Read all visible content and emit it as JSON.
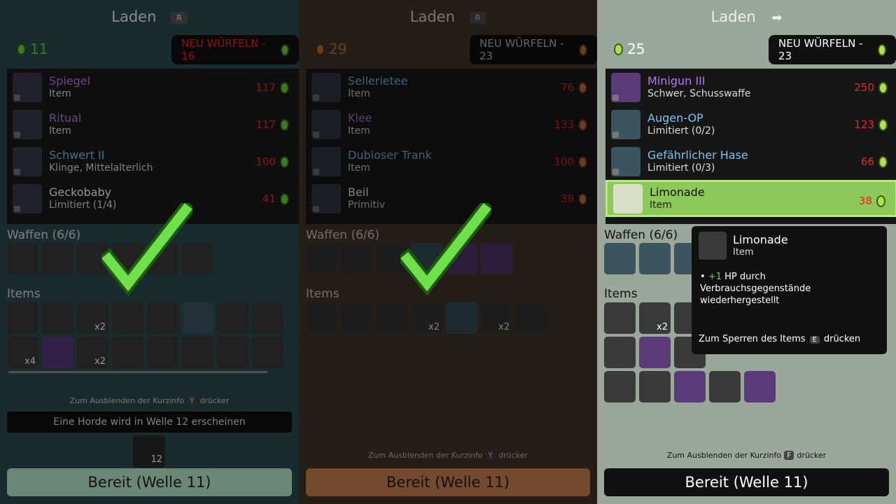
{
  "panels": [
    {
      "title": "Laden",
      "key_hint": "R",
      "coins": "11",
      "reroll_label": "NEU WÜRFELN - 16",
      "shop": [
        {
          "name": "Spiegel",
          "sub": "Item",
          "price": "117",
          "color": "purple"
        },
        {
          "name": "Ritual",
          "sub": "Item",
          "price": "117",
          "color": "purple"
        },
        {
          "name": "Schwert II",
          "sub": "Klinge, Mittelalterlich",
          "price": "100",
          "color": "blue"
        },
        {
          "name": "Geckobaby",
          "sub": "Limitiert (1/4)",
          "price": "41",
          "color": "white"
        }
      ],
      "weapons_label": "Waffen (6/6)",
      "items_label": "Items",
      "item_counts": [
        "x2",
        "x4",
        "x2"
      ],
      "hint": "Zum Ausblenden der Kurzinfo",
      "hint_key": "Y",
      "hint_end": "drücker",
      "horde": "Eine Horde wird in Welle 12 erscheinen",
      "horde_count": "12",
      "ready": "Bereit (Welle 11)"
    },
    {
      "title": "Laden",
      "key_hint": "R",
      "coins": "29",
      "reroll_label": "NEU WÜRFELN - 23",
      "shop": [
        {
          "name": "Sellerietee",
          "sub": "Item",
          "price": "76",
          "color": "blue"
        },
        {
          "name": "Klee",
          "sub": "Item",
          "price": "133",
          "color": "purple"
        },
        {
          "name": "Dubioser Trank",
          "sub": "Item",
          "price": "100",
          "color": "blue"
        },
        {
          "name": "Beil",
          "sub": "Primitiv",
          "price": "38",
          "color": "white"
        }
      ],
      "weapons_label": "Waffen (6/6)",
      "items_label": "Items",
      "item_counts": [
        "x2",
        "x2"
      ],
      "hint": "Zum Ausblenden der Kurzinfo",
      "hint_key": "Y",
      "hint_end": "drücker",
      "ready": "Bereit (Welle 11)"
    },
    {
      "title": "Laden",
      "coins": "25",
      "reroll_label": "NEU WÜRFELN - 23",
      "shop": [
        {
          "name": "Minigun III",
          "sub": "Schwer, Schusswaffe",
          "price": "250",
          "color": "purple"
        },
        {
          "name": "Augen-OP",
          "sub": "Limitiert (0/2)",
          "price": "123",
          "color": "blue"
        },
        {
          "name": "Gefährlicher Hase",
          "sub": "Limitiert (0/3)",
          "price": "66",
          "color": "blue"
        },
        {
          "name": "Limonade",
          "sub": "Item",
          "price": "38",
          "color": "white"
        }
      ],
      "weapons_label": "Waffen (6/6)",
      "items_label": "Items",
      "item_counts": [
        "x2"
      ],
      "hint": "Zum Ausblenden der Kurzinfo",
      "hint_key": "F",
      "hint_end": "drücker",
      "ready": "Bereit (Welle 11)"
    }
  ],
  "tooltip": {
    "name": "Limonade",
    "sub": "Item",
    "bonus": "+1",
    "desc": "HP durch Verbrauchsgegenstände wiederhergestellt",
    "foot_pre": "Zum Sperren des Items",
    "foot_key": "E",
    "foot_post": "drücken"
  },
  "colors": {
    "accent_green": "#6fd043",
    "price_red": "#e22",
    "selected": "#8dc85a"
  }
}
